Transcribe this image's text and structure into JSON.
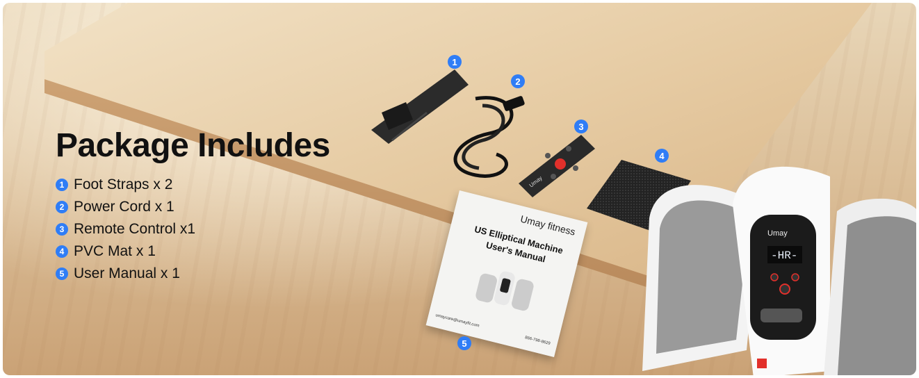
{
  "title": "Package Includes",
  "items": [
    {
      "num": "1",
      "text": "Foot Straps x 2"
    },
    {
      "num": "2",
      "text": "Power Cord x 1"
    },
    {
      "num": "3",
      "text": "Remote Control x1"
    },
    {
      "num": "4",
      "text": "PVC Mat x 1"
    },
    {
      "num": "5",
      "text": "User Manual x 1"
    }
  ],
  "badges": [
    "1",
    "2",
    "3",
    "4",
    "5"
  ],
  "manual": {
    "brand": "Umay fitness",
    "title": "US Elliptical Machine User's Manual",
    "email": "umaycare@umayfit.com",
    "phone": "866-798-8629"
  },
  "remote_brand": "Umay",
  "device": {
    "brand": "Umay",
    "display": "-HR-"
  },
  "colors": {
    "accent": "#2f7df6",
    "text": "#111111"
  }
}
